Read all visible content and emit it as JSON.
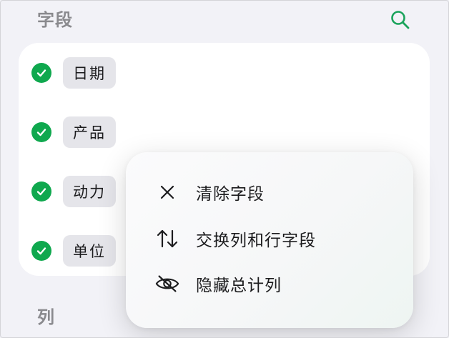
{
  "header": {
    "fields_title": "字段",
    "search_icon": "search-icon",
    "accent_color": "#1aa35b"
  },
  "fields": [
    {
      "label": "日期",
      "checked": true
    },
    {
      "label": "产品",
      "checked": true
    },
    {
      "label": "动力",
      "checked": true
    },
    {
      "label": "单位",
      "checked": true
    }
  ],
  "columns_section": {
    "title": "列"
  },
  "context_menu": {
    "items": [
      {
        "label": "清除字段",
        "icon": "close-icon"
      },
      {
        "label": "交换列和行字段",
        "icon": "swap-arrows-icon"
      },
      {
        "label": "隐藏总计列",
        "icon": "eye-slash-icon"
      }
    ]
  },
  "colors": {
    "check": "#0fa84e",
    "chip_bg": "#e5e5ea",
    "page_bg": "#f2f2f7"
  }
}
